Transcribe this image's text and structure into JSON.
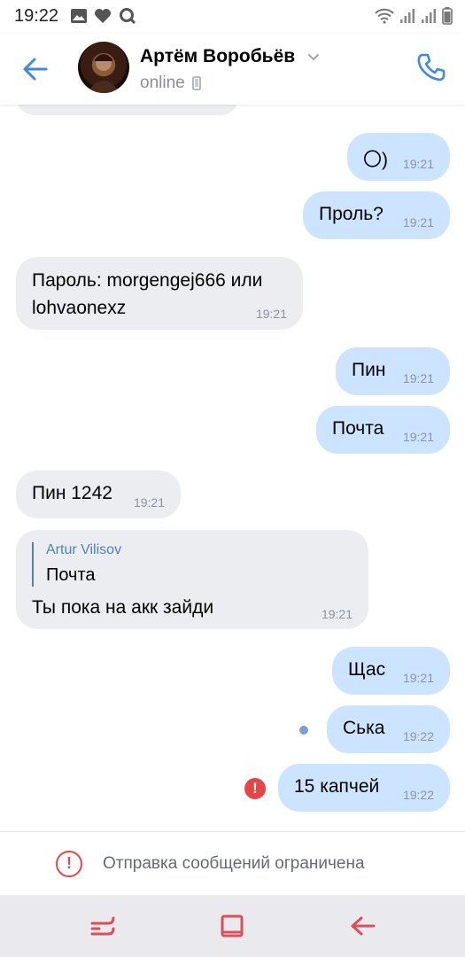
{
  "status_bar": {
    "time": "19:22",
    "left_icons": [
      "image-icon",
      "heart-icon",
      "q-icon"
    ],
    "right_icons": [
      "wifi-icon",
      "signal-icon",
      "signal-icon",
      "battery-icon"
    ]
  },
  "header": {
    "contact_name": "Артём Воробьёв",
    "status": "online",
    "accent_color": "#3f8ae0"
  },
  "messages": [
    {
      "direction": "out",
      "text": "〇)",
      "time": "19:21"
    },
    {
      "direction": "out",
      "text": "Проль?",
      "time": "19:21"
    },
    {
      "direction": "in",
      "text_line1": "Пароль: morgengej666 или",
      "text_line2": "lohvaonexz",
      "time": "19:21"
    },
    {
      "direction": "out",
      "text": "Пин",
      "time": "19:21"
    },
    {
      "direction": "out",
      "text": "Почта",
      "time": "19:21"
    },
    {
      "direction": "in",
      "text": "Пин 1242",
      "time": "19:21"
    },
    {
      "direction": "in",
      "reply_author": "Artur Vilisov",
      "reply_text": "Почта",
      "text": "Ты пока на акк зайди",
      "time": "19:21"
    },
    {
      "direction": "out",
      "text": "Щас",
      "time": "19:21"
    },
    {
      "direction": "out",
      "text": "Ська",
      "time": "19:22",
      "state": "sending"
    },
    {
      "direction": "out",
      "text": "15 капчей",
      "time": "19:22",
      "state": "error"
    }
  ],
  "banner": {
    "text": "Отправка сообщений ограничена",
    "icon_symbol": "!",
    "color": "#e64646"
  },
  "error_symbol": "!",
  "nav": [
    "recent-apps-icon",
    "home-icon",
    "back-icon"
  ]
}
